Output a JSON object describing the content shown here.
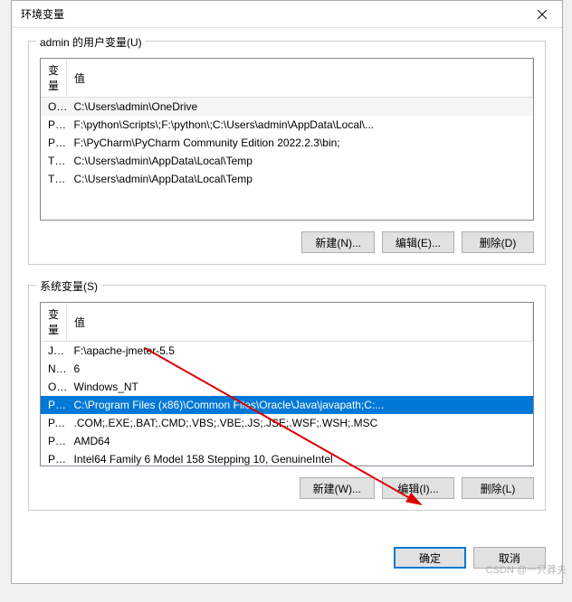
{
  "dialog": {
    "title": "环境变量"
  },
  "userVars": {
    "legend": "admin 的用户变量(U)",
    "headers": {
      "var": "变量",
      "val": "值"
    },
    "rows": [
      {
        "var": "OneDrive",
        "val": "C:\\Users\\admin\\OneDrive"
      },
      {
        "var": "Path",
        "val": "F:\\python\\Scripts\\;F:\\python\\;C:\\Users\\admin\\AppData\\Local\\..."
      },
      {
        "var": "PyCharm Community Editi...",
        "val": "F:\\PyCharm\\PyCharm Community Edition 2022.2.3\\bin;"
      },
      {
        "var": "TEMP",
        "val": "C:\\Users\\admin\\AppData\\Local\\Temp"
      },
      {
        "var": "TMP",
        "val": "C:\\Users\\admin\\AppData\\Local\\Temp"
      }
    ],
    "buttons": {
      "new": "新建(N)...",
      "edit": "编辑(E)...",
      "del": "删除(D)"
    }
  },
  "sysVars": {
    "legend": "系统变量(S)",
    "headers": {
      "var": "变量",
      "val": "值"
    },
    "rows": [
      {
        "var": "JMETER_HOME",
        "val": "F:\\apache-jmeter-5.5"
      },
      {
        "var": "NUMBER_OF_PROCESSORS",
        "val": "6"
      },
      {
        "var": "OS",
        "val": "Windows_NT"
      },
      {
        "var": "Path",
        "val": "C:\\Program Files (x86)\\Common Files\\Oracle\\Java\\javapath;C:..."
      },
      {
        "var": "PATHEXT",
        "val": ".COM;.EXE;.BAT;.CMD;.VBS;.VBE;.JS;.JSE;.WSF;.WSH;.MSC"
      },
      {
        "var": "PROCESSOR_ARCHITECT...",
        "val": "AMD64"
      },
      {
        "var": "PROCESSOR_IDENTIFIER",
        "val": "Intel64 Family 6 Model 158 Stepping 10, GenuineIntel"
      }
    ],
    "selectedIndex": 3,
    "buttons": {
      "new": "新建(W)...",
      "edit": "编辑(I)...",
      "del": "删除(L)"
    }
  },
  "footer": {
    "ok": "确定",
    "cancel": "取消"
  },
  "watermark": "CSDN @一只莽夫"
}
